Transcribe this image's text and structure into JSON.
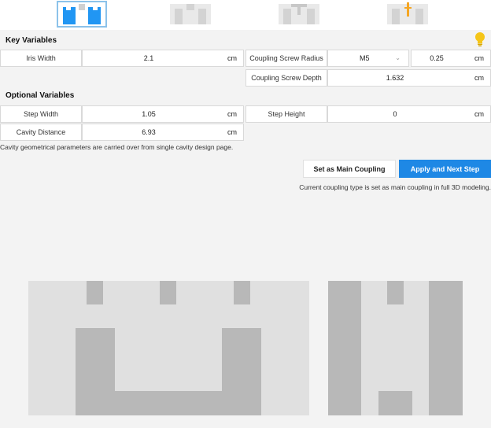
{
  "tabs": [
    {
      "name": "coupling-type-1",
      "active": true
    },
    {
      "name": "coupling-type-2",
      "active": false
    },
    {
      "name": "coupling-type-3",
      "active": false
    },
    {
      "name": "coupling-type-4",
      "active": false
    }
  ],
  "key_variables": {
    "title": "Key Variables",
    "iris_width": {
      "label": "Iris Width",
      "value": "2.1",
      "unit": "cm"
    },
    "coupling_screw_radius": {
      "label": "Coupling Screw Radius",
      "select_value": "M5",
      "value": "0.25",
      "unit": "cm"
    },
    "coupling_screw_depth": {
      "label": "Coupling Screw Depth",
      "value": "1.632",
      "unit": "cm"
    }
  },
  "optional_variables": {
    "title": "Optional Variables",
    "step_width": {
      "label": "Step Width",
      "value": "1.05",
      "unit": "cm"
    },
    "step_height": {
      "label": "Step Height",
      "value": "0",
      "unit": "cm"
    },
    "cavity_distance": {
      "label": "Cavity Distance",
      "value": "6.93",
      "unit": "cm"
    }
  },
  "notes": {
    "cavity_note": "Cavity geometrical parameters are carried over from single cavity design page.",
    "coupling_note": "Current coupling type is set as main coupling in full 3D modeling."
  },
  "buttons": {
    "set_main": "Set as Main Coupling",
    "apply_next": "Apply and Next Step"
  },
  "colors": {
    "accent": "#1e88e5",
    "active_tab_border": "#8cc2ea",
    "tip_icon": "#f5c518"
  },
  "icons": {
    "tip": "lightbulb-icon"
  }
}
